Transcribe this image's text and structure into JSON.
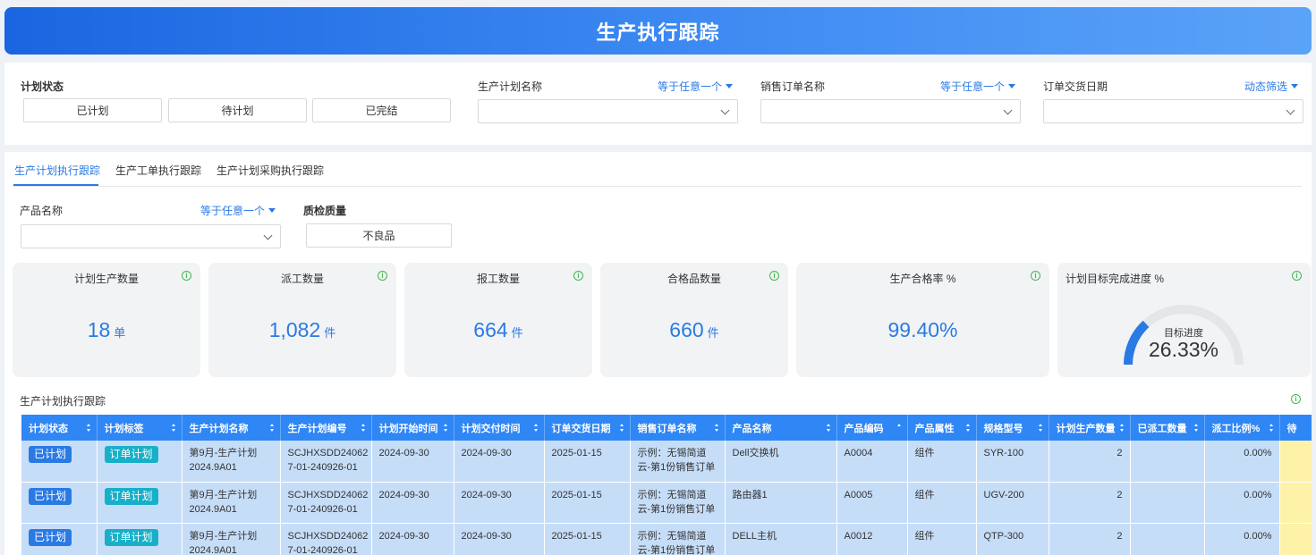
{
  "header": {
    "title": "生产执行跟踪"
  },
  "filters": {
    "plan_status": {
      "label": "计划状态",
      "options": [
        "已计划",
        "待计划",
        "已完结"
      ]
    },
    "plan_name": {
      "label": "生产计划名称",
      "operator": "等于任意一个"
    },
    "sales_order": {
      "label": "销售订单名称",
      "operator": "等于任意一个"
    },
    "delivery_date": {
      "label": "订单交货日期",
      "operator": "动态筛选"
    }
  },
  "tabs": [
    "生产计划执行跟踪",
    "生产工单执行跟踪",
    "生产计划采购执行跟踪"
  ],
  "sub_filters": {
    "product_name": {
      "label": "产品名称",
      "operator": "等于任意一个"
    },
    "quality": {
      "label": "质检质量",
      "option": "不良品"
    }
  },
  "kpis": [
    {
      "title": "计划生产数量",
      "value": "18",
      "unit": "单"
    },
    {
      "title": "派工数量",
      "value": "1,082",
      "unit": "件"
    },
    {
      "title": "报工数量",
      "value": "664",
      "unit": "件"
    },
    {
      "title": "合格品数量",
      "value": "660",
      "unit": "件"
    },
    {
      "title": "生产合格率 %",
      "value": "99.40%",
      "unit": ""
    }
  ],
  "progress": {
    "title": "计划目标完成进度 %",
    "label": "目标进度",
    "value": "26.33%",
    "fraction": 0.2633
  },
  "table": {
    "title": "生产计划执行跟踪",
    "columns": [
      "计划状态",
      "计划标签",
      "生产计划名称",
      "生产计划编号",
      "计划开始时间",
      "计划交付时间",
      "订单交货日期",
      "销售订单名称",
      "产品名称",
      "产品编码",
      "产品属性",
      "规格型号",
      "计划生产数量",
      "已派工数量",
      "派工比例%",
      "待"
    ],
    "rows": [
      {
        "status": "已计划",
        "tag": "订单计划",
        "plan_name": [
          "第9月-生产计划",
          "2024.9A01"
        ],
        "plan_no": [
          "SCJHXSDD24062",
          "7-01-240926-01"
        ],
        "start": "2024-09-30",
        "delivery": "2024-09-30",
        "order_date": "2025-01-15",
        "order_name": [
          "示例：无锡简道",
          "云-第1份销售订单"
        ],
        "product": "Dell交换机",
        "code": "A0004",
        "attr": "组件",
        "spec": "SYR-100",
        "qty": "2",
        "dispatched": "",
        "ratio": "0.00%"
      },
      {
        "status": "已计划",
        "tag": "订单计划",
        "plan_name": [
          "第9月-生产计划",
          "2024.9A01"
        ],
        "plan_no": [
          "SCJHXSDD24062",
          "7-01-240926-01"
        ],
        "start": "2024-09-30",
        "delivery": "2024-09-30",
        "order_date": "2025-01-15",
        "order_name": [
          "示例：无锡简道",
          "云-第1份销售订单"
        ],
        "product": "路由器1",
        "code": "A0005",
        "attr": "组件",
        "spec": "UGV-200",
        "qty": "2",
        "dispatched": "",
        "ratio": "0.00%"
      },
      {
        "status": "已计划",
        "tag": "订单计划",
        "plan_name": [
          "第9月-生产计划",
          "2024.9A01"
        ],
        "plan_no": [
          "SCJHXSDD24062",
          "7-01-240926-01"
        ],
        "start": "2024-09-30",
        "delivery": "2024-09-30",
        "order_date": "2025-01-15",
        "order_name": [
          "示例：无锡简道",
          "云-第1份销售订单"
        ],
        "product": "DELL主机",
        "code": "A0012",
        "attr": "组件",
        "spec": "QTP-300",
        "qty": "2",
        "dispatched": "",
        "ratio": "0.00%"
      }
    ]
  },
  "colors": {
    "accent": "#2a7ae4",
    "header_start": "#1a66e0",
    "header_end": "#5ba3f8",
    "table_header": "#2f86f5",
    "row_bg": "#c6ddf8",
    "badge_teal": "#18b0c8",
    "info_green": "#3fb94f"
  }
}
